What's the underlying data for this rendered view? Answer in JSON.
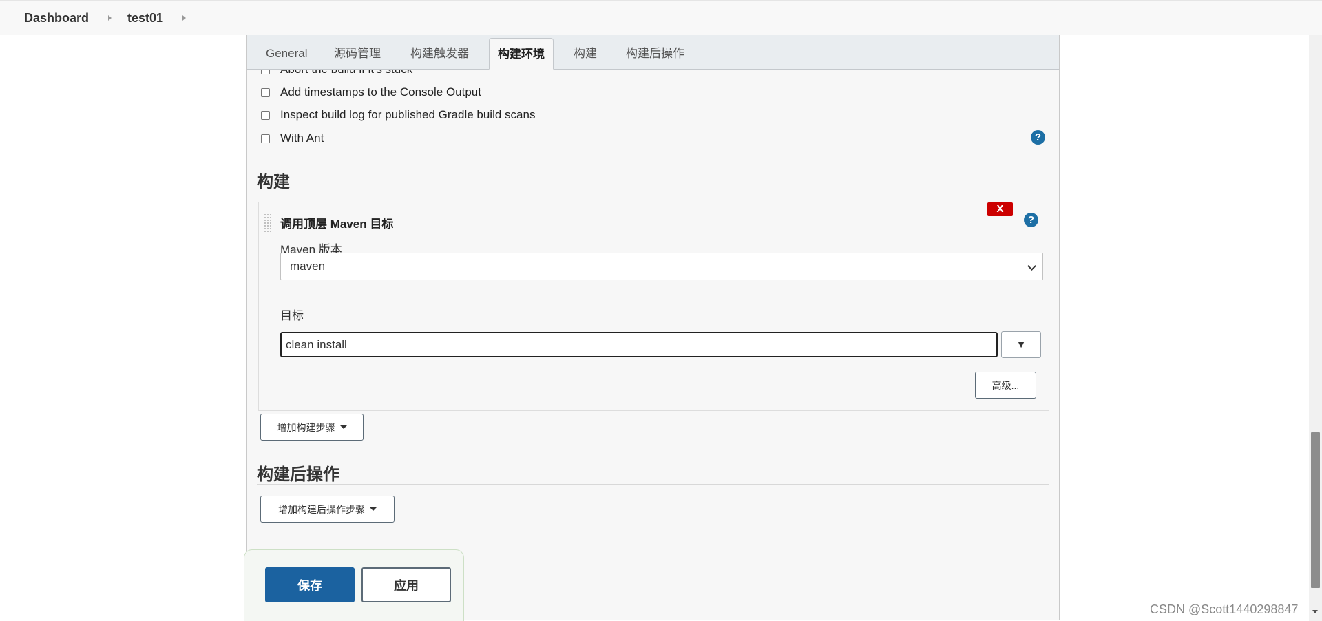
{
  "breadcrumb": {
    "items": [
      "Dashboard",
      "test01"
    ]
  },
  "tabs": [
    {
      "label": "General",
      "active": false
    },
    {
      "label": "源码管理",
      "active": false
    },
    {
      "label": "构建触发器",
      "active": false
    },
    {
      "label": "构建环境",
      "active": true
    },
    {
      "label": "构建",
      "active": false
    },
    {
      "label": "构建后操作",
      "active": false
    }
  ],
  "build_env": {
    "options": [
      {
        "label": "Abort the build if it's stuck",
        "checked": false
      },
      {
        "label": "Add timestamps to the Console Output",
        "checked": false
      },
      {
        "label": "Inspect build log for published Gradle build scans",
        "checked": false
      },
      {
        "label": "With Ant",
        "checked": false
      }
    ]
  },
  "build": {
    "section_title": "构建",
    "step": {
      "title": "调用顶层 Maven 目标",
      "delete_label": "X",
      "maven_version_label": "Maven 版本",
      "maven_version_value": "maven",
      "goals_label": "目标",
      "goals_value": "clean install",
      "expand_glyph": "▼",
      "advanced_label": "高级..."
    },
    "add_step_label": "增加构建步骤"
  },
  "post_build": {
    "section_title": "构建后操作",
    "add_step_label": "增加构建后操作步骤"
  },
  "actions": {
    "save_label": "保存",
    "apply_label": "应用"
  },
  "help_glyph": "?",
  "watermark": "CSDN @Scott1440298847",
  "colors": {
    "primary": "#1b62a0",
    "danger": "#cc0000",
    "help": "#1d6fa5"
  }
}
